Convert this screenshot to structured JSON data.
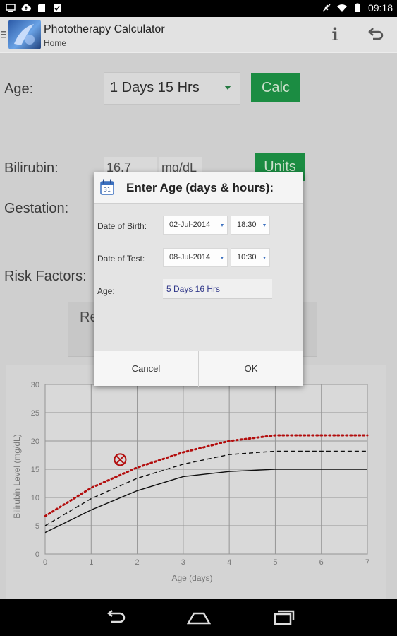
{
  "status_bar": {
    "time": "09:18",
    "left_icons": [
      "screen-icon",
      "cloud-upload-icon",
      "sd-card-icon",
      "clipboard-icon"
    ],
    "right_icons": [
      "no-signal-icon",
      "wifi-icon",
      "battery-icon"
    ]
  },
  "action_bar": {
    "title": "Phototherapy Calculator",
    "subtitle": "Home",
    "info_glyph": "i"
  },
  "form": {
    "age_label": "Age:",
    "age_value": "1 Days 15 Hrs",
    "calc_label": "Calc",
    "bilirubin_label": "Bilirubin:",
    "bilirubin_value": "16.7",
    "bilirubin_unit": "mg/dL",
    "units_label": "Units",
    "gestation_label": "Gestation:",
    "risk_label": "Risk Factors:",
    "risk_button_partial": "Re"
  },
  "dialog": {
    "title": "Enter Age (days & hours):",
    "dob_label": "Date of Birth:",
    "dob_date": "02-Jul-2014",
    "dob_time": "18:30",
    "dot_label": "Date of Test:",
    "dot_date": "08-Jul-2014",
    "dot_time": "10:30",
    "age_label": "Age:",
    "age_value": "5 Days 16 Hrs",
    "cancel_label": "Cancel",
    "ok_label": "OK"
  },
  "chart_data": {
    "type": "line",
    "xlabel": "Age (days)",
    "ylabel": "Bilirubin Level (mg/dL)",
    "xlim": [
      0,
      7
    ],
    "ylim": [
      0,
      30
    ],
    "x_ticks": [
      "0",
      "1",
      "2",
      "3",
      "4",
      "5",
      "6",
      "7"
    ],
    "y_ticks": [
      "0",
      "5",
      "10",
      "15",
      "20",
      "25",
      "30"
    ],
    "grid": true,
    "series": [
      {
        "style": "dotted-red",
        "color": "#cc1111",
        "x": [
          0,
          1,
          2,
          3,
          4,
          5,
          6,
          7
        ],
        "y": [
          6.7,
          11.7,
          15.3,
          18,
          20,
          21,
          21,
          21
        ]
      },
      {
        "style": "dashed-black",
        "color": "#111111",
        "x": [
          0,
          1,
          2,
          3,
          4,
          5,
          6,
          7
        ],
        "y": [
          5,
          9.8,
          13.4,
          15.9,
          17.6,
          18.2,
          18.2,
          18.2
        ]
      },
      {
        "style": "solid-black",
        "color": "#111111",
        "x": [
          0,
          1,
          2,
          3,
          4,
          5,
          6,
          7
        ],
        "y": [
          3.8,
          7.8,
          11.2,
          13.7,
          14.6,
          15,
          15,
          15
        ]
      }
    ],
    "marker": {
      "x": 1.63,
      "y": 16.7,
      "color": "#cc1111",
      "shape": "circle-x"
    }
  },
  "navbar": {
    "icons": [
      "back-icon",
      "home-icon",
      "recent-apps-icon"
    ]
  }
}
